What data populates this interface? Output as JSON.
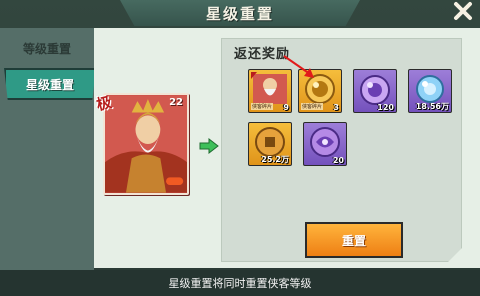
{
  "window": {
    "title": "星级重置"
  },
  "sidebar": {
    "tabs": [
      {
        "label": "等级重置",
        "active": false
      },
      {
        "label": "星级重置",
        "active": true
      }
    ]
  },
  "hero": {
    "level": "22",
    "rarity_badge": "极"
  },
  "rewards": {
    "title": "返还奖励",
    "items": [
      {
        "icon": "hero-shard-icon",
        "count": "9",
        "tag": "侠客碎片"
      },
      {
        "icon": "gold-orb-icon",
        "count": "3",
        "tag": "侠客碎片"
      },
      {
        "icon": "purple-orb-icon",
        "count": "120"
      },
      {
        "icon": "blue-crystal-icon",
        "count": "18.56万"
      },
      {
        "icon": "copper-coin-icon",
        "count": "25.2万"
      },
      {
        "icon": "purple-swirl-icon",
        "count": "20"
      }
    ]
  },
  "actions": {
    "reset_label": "重置"
  },
  "footer": {
    "note": "星级重置将同时重置侠客等级"
  },
  "colors": {
    "accent": "#2f9a86",
    "button": "#ee7f14",
    "hero_card": "#c94d47",
    "item_gold": "#e0941a",
    "item_purple": "#7451bc"
  }
}
